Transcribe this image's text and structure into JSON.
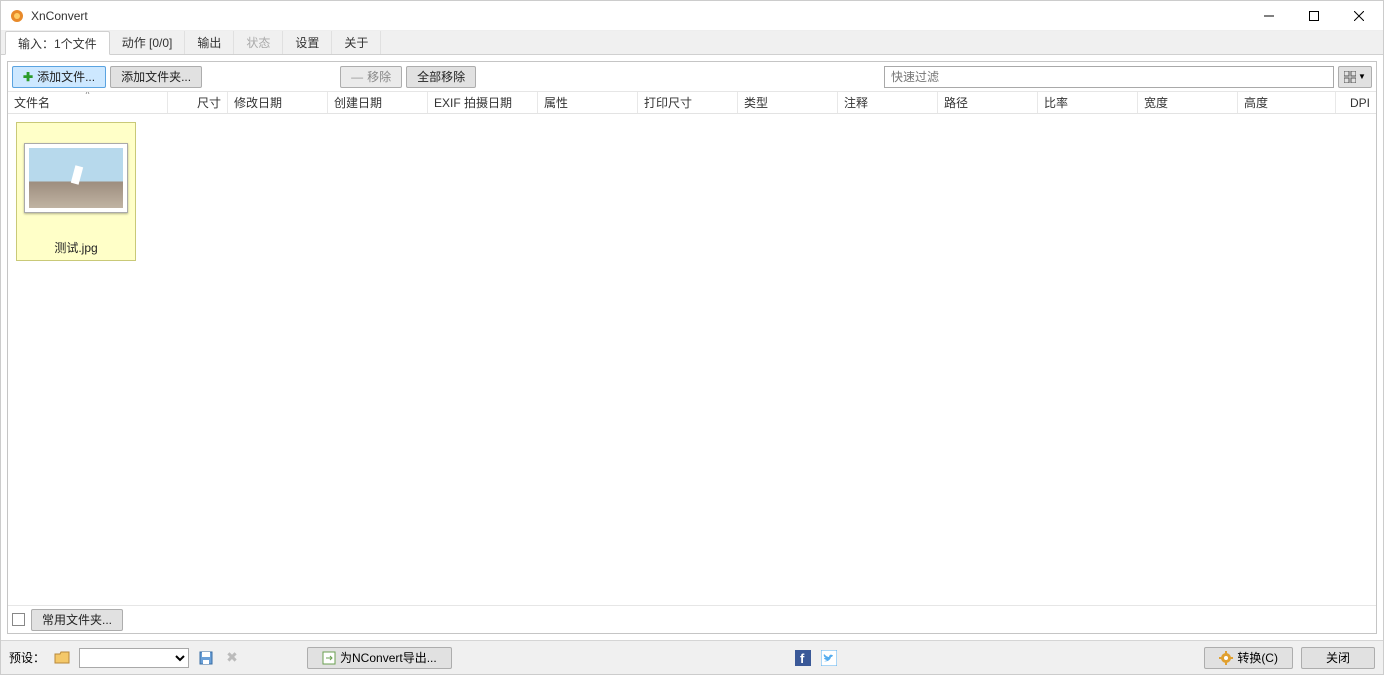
{
  "window": {
    "title": "XnConvert"
  },
  "tabs": [
    {
      "label": "输入：1个文件",
      "active": true,
      "disabled": false
    },
    {
      "label": "动作 [0/0]",
      "active": false,
      "disabled": false
    },
    {
      "label": "输出",
      "active": false,
      "disabled": false
    },
    {
      "label": "状态",
      "active": false,
      "disabled": true
    },
    {
      "label": "设置",
      "active": false,
      "disabled": false
    },
    {
      "label": "关于",
      "active": false,
      "disabled": false
    }
  ],
  "toolbar": {
    "add_file": "添加文件...",
    "add_folder": "添加文件夹...",
    "remove": "移除",
    "remove_all": "全部移除",
    "filter_placeholder": "快速过滤"
  },
  "columns": {
    "filename": "文件名",
    "size": "尺寸",
    "modified": "修改日期",
    "created": "创建日期",
    "exif": "EXIF 拍摄日期",
    "attrs": "属性",
    "print_size": "打印尺寸",
    "type": "类型",
    "comment": "注释",
    "path": "路径",
    "ratio": "比率",
    "width": "宽度",
    "height": "高度",
    "dpi": "DPI"
  },
  "files": [
    {
      "name": "测试.jpg"
    }
  ],
  "bottom": {
    "hot_folder": "常用文件夹..."
  },
  "statusbar": {
    "preset_label": "预设：",
    "export": "为NConvert导出...",
    "convert": "转换(C)",
    "close": "关闭"
  }
}
